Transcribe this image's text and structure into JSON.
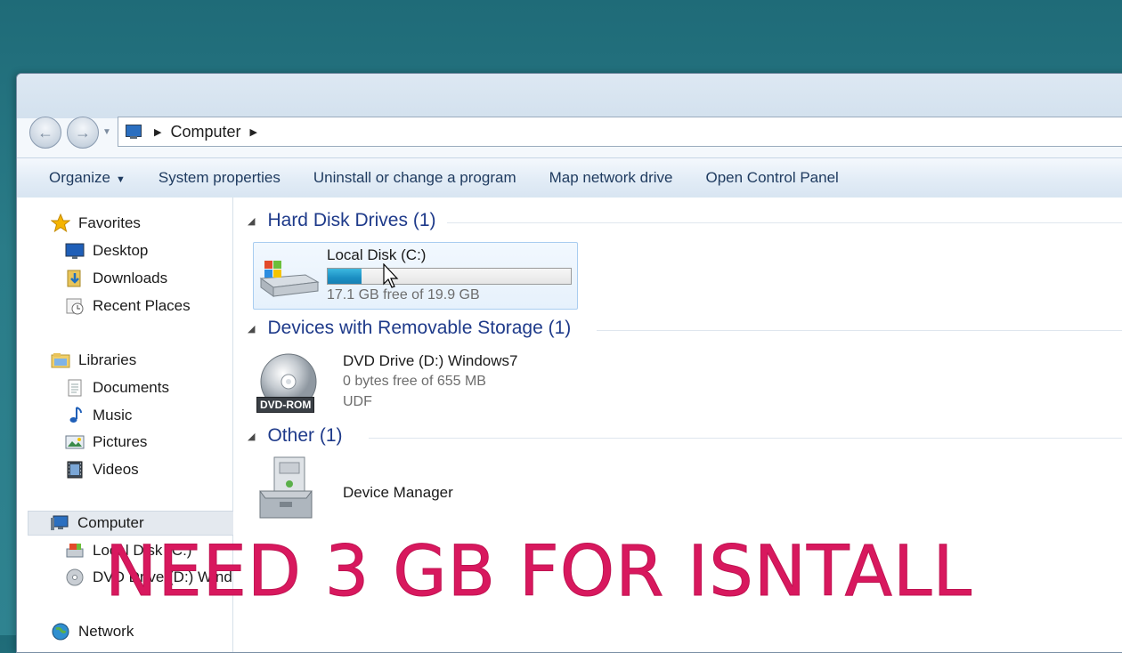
{
  "address": {
    "segments": [
      "Computer"
    ]
  },
  "toolbar": {
    "organize": "Organize",
    "system_properties": "System properties",
    "uninstall": "Uninstall or change a program",
    "map_drive": "Map network drive",
    "control_panel": "Open Control Panel"
  },
  "sidebar": {
    "favorites": "Favorites",
    "desktop": "Desktop",
    "downloads": "Downloads",
    "recent": "Recent Places",
    "libraries": "Libraries",
    "documents": "Documents",
    "music": "Music",
    "pictures": "Pictures",
    "videos": "Videos",
    "computer": "Computer",
    "local_disk": "Local Disk (C:)",
    "dvd_drive": "DVD Drive (D:) Wind",
    "network": "Network"
  },
  "groups": {
    "hdd": "Hard Disk Drives (1)",
    "removable": "Devices with Removable Storage (1)",
    "other": "Other (1)"
  },
  "items": {
    "local_disk": {
      "name": "Local Disk (C:)",
      "free": "17.1 GB free of 19.9 GB",
      "used_fraction": 0.14
    },
    "dvd": {
      "name": "DVD Drive (D:) Windows7",
      "free": "0 bytes free of 655 MB",
      "fs": "UDF",
      "badge": "DVD-ROM"
    },
    "device_manager": {
      "name": "Device Manager"
    }
  },
  "overlay": {
    "caption": "NEED 3 GB FOR ISNTALL"
  },
  "colors": {
    "accent": "#1e3a8a",
    "overlay": "#d8185e",
    "bar_fill": "#1c8fc3"
  }
}
